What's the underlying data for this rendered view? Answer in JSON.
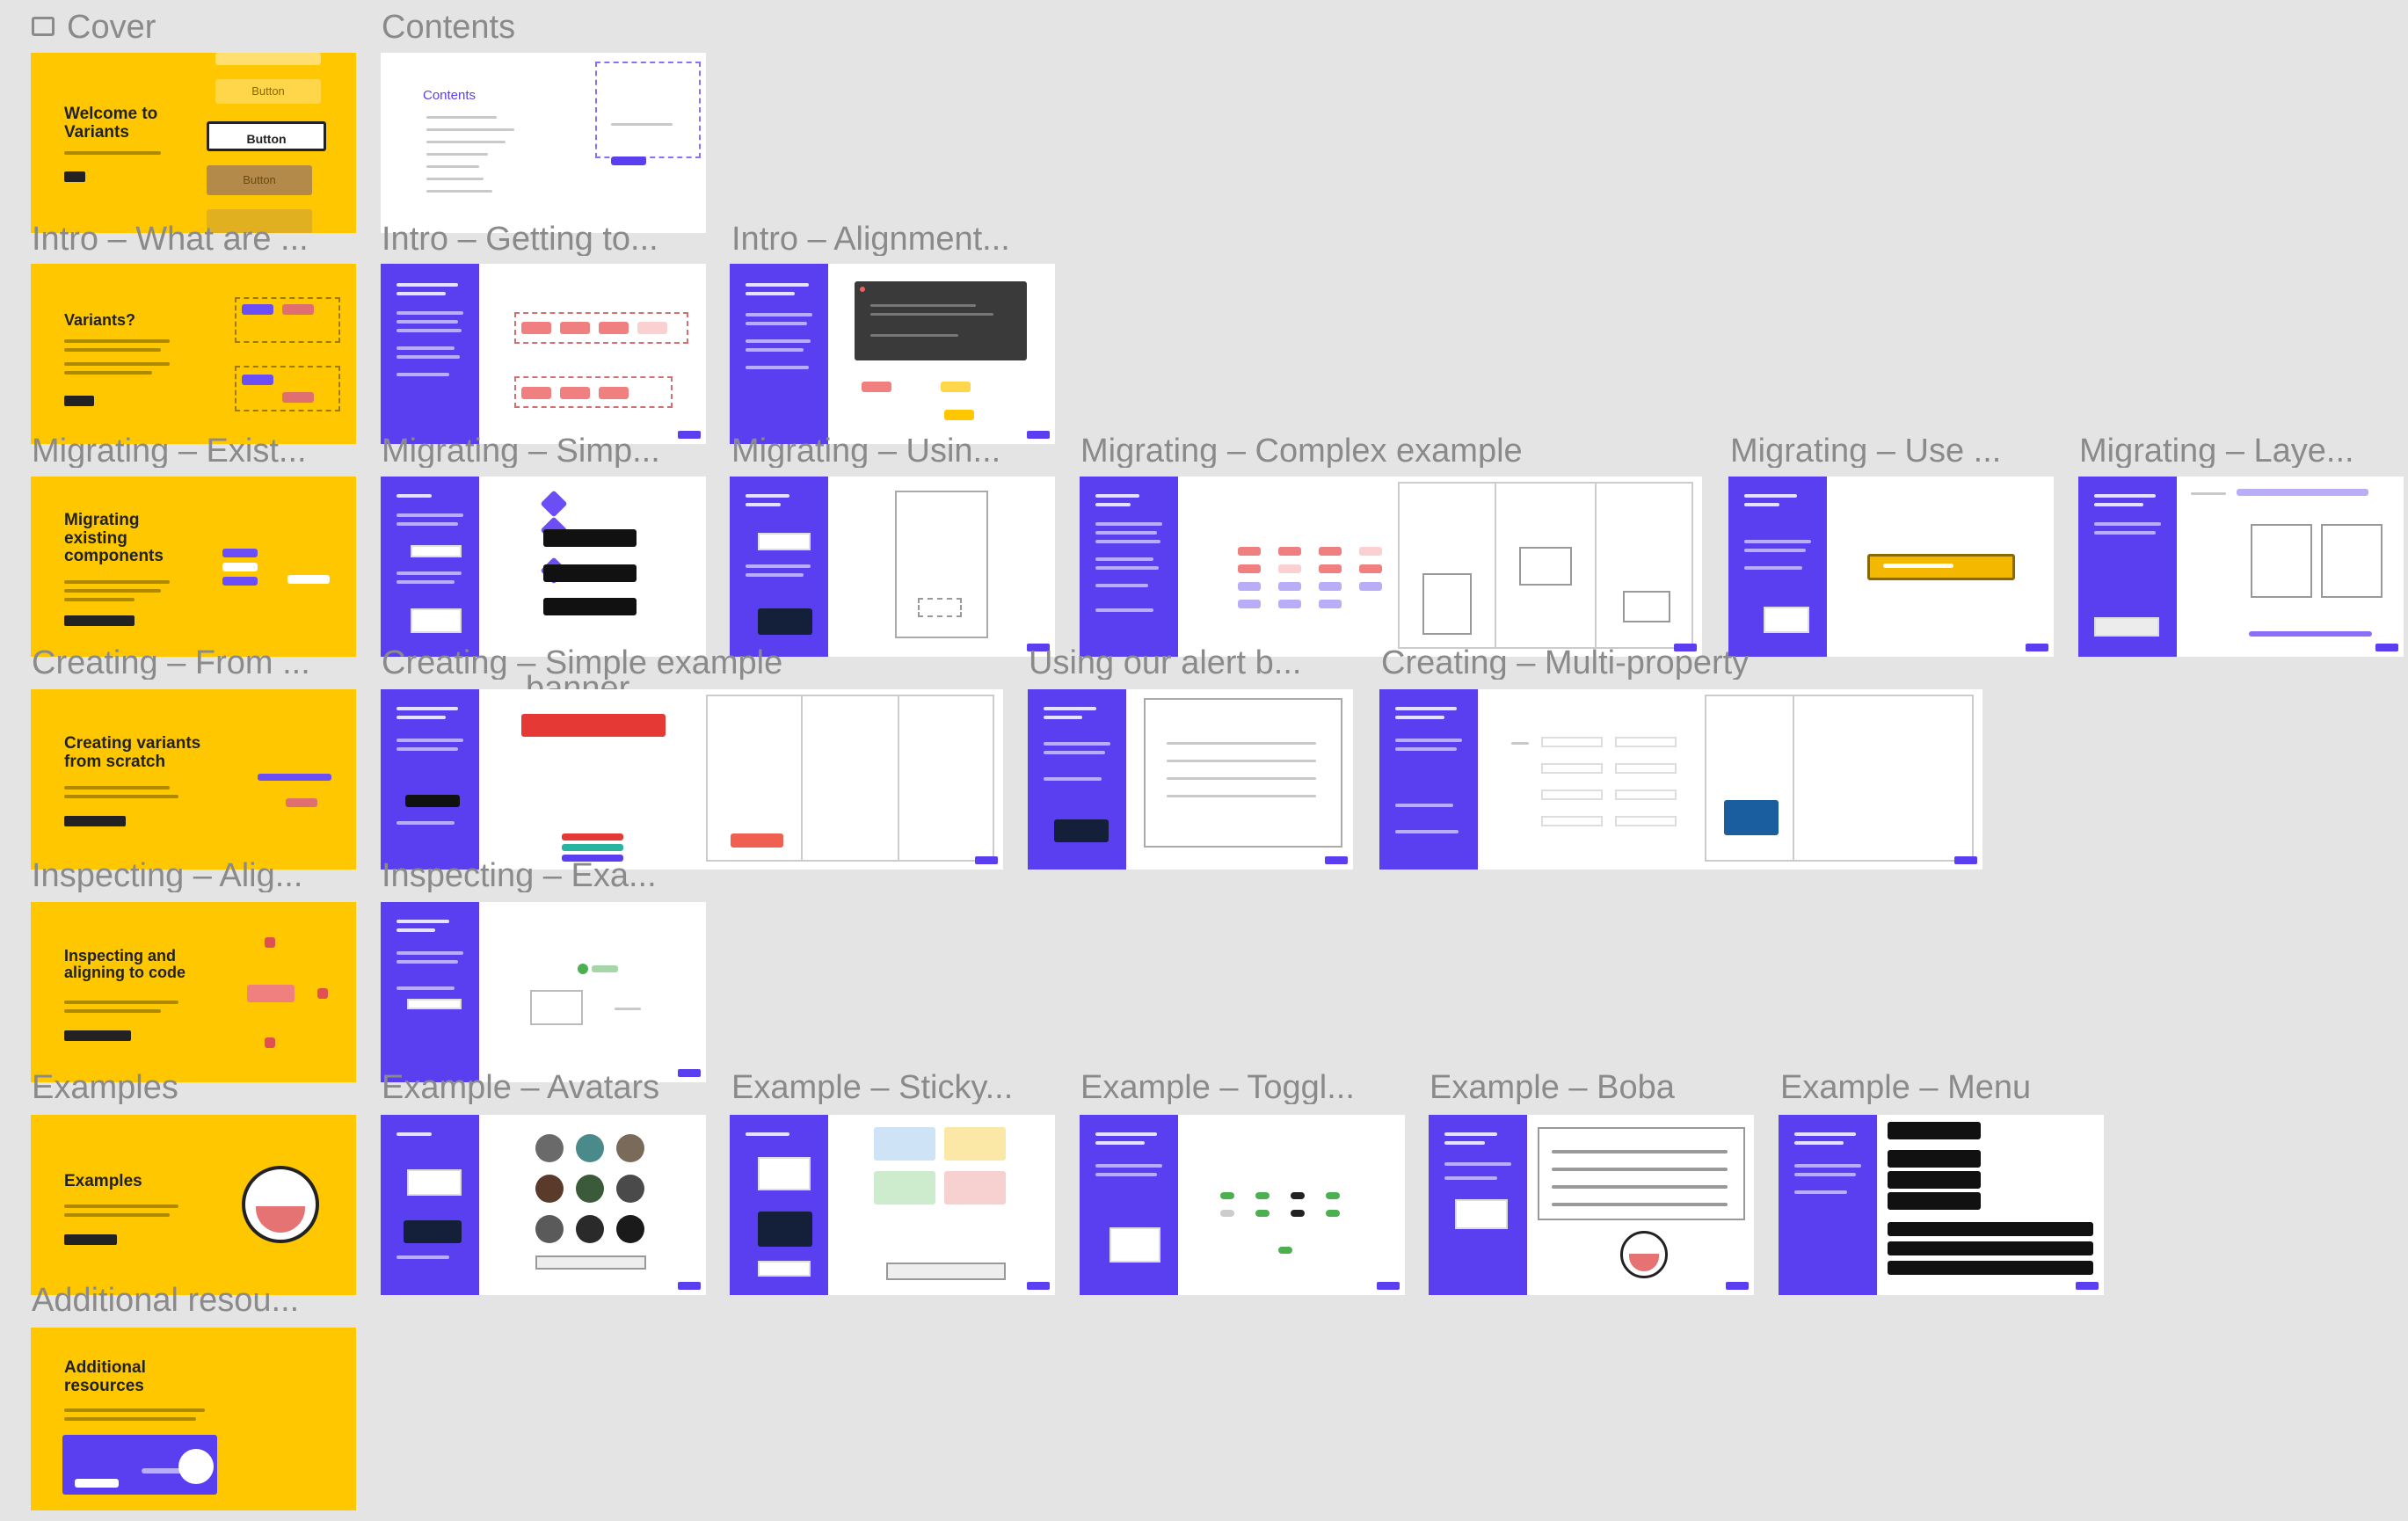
{
  "labels": {
    "cover": "Cover",
    "contents": "Contents",
    "intro_what": "Intro – What are ...",
    "intro_getting": "Intro – Getting to...",
    "intro_alignment": "Intro – Alignment...",
    "migrating_exist": "Migrating – Exist...",
    "migrating_simp": "Migrating – Simp...",
    "migrating_usin": "Migrating – Usin...",
    "migrating_complex": "Migrating – Complex example",
    "migrating_use": "Migrating – Use ...",
    "migrating_laye": "Migrating – Laye...",
    "creating_from": "Creating – From ...",
    "creating_simple": "Creating – Simple example",
    "creating_simple_banner": "banner",
    "using_alert": "Using our alert b...",
    "creating_multi": "Creating – Multi-property",
    "inspecting_alig": "Inspecting – Alig...",
    "inspecting_exa": "Inspecting – Exa...",
    "examples": "Examples",
    "example_avatars": "Example – Avatars",
    "example_sticky": "Example – Sticky...",
    "example_toggl": "Example – Toggl...",
    "example_boba": "Example – Boba",
    "example_menu": "Example – Menu",
    "additional": "Additional resou..."
  },
  "thumbs": {
    "cover_title": "Welcome to Variants",
    "cover_button": "Button",
    "contents_heading": "Contents",
    "intro_what_title": "Variants?",
    "migrating_title": "Migrating existing components",
    "creating_title": "Creating variants from scratch",
    "inspecting_title": "Inspecting and aligning to code",
    "examples_title": "Examples",
    "additional_title": "Additional resources"
  },
  "colors": {
    "canvas": "#e4e4e4",
    "yellow": "#ffc700",
    "purple": "#5a3ff0",
    "label": "#8a8a8a"
  }
}
